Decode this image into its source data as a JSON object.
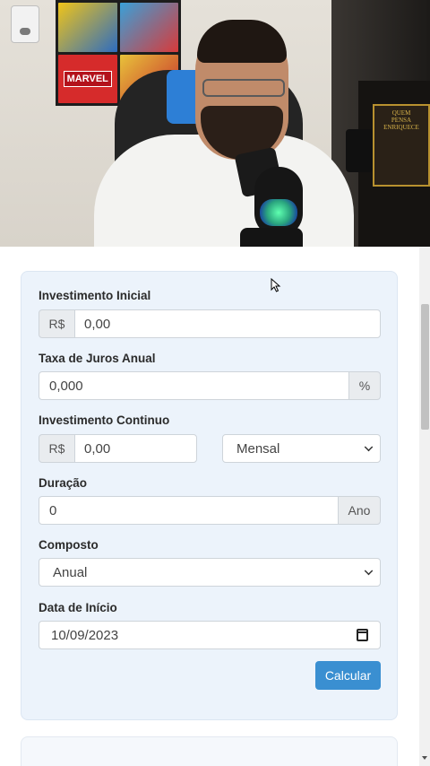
{
  "video": {
    "poster_text": "MARVEL COMICS",
    "book_text": "NAPOLEON HILL QUEM PENSA ENRIQUECE"
  },
  "form": {
    "initial_label": "Investimento Inicial",
    "initial_prefix": "R$",
    "initial_value": "0,00",
    "rate_label": "Taxa de Juros Anual",
    "rate_value": "0,000",
    "rate_suffix": "%",
    "contrib_label": "Investimento Continuo",
    "contrib_prefix": "R$",
    "contrib_value": "0,00",
    "contrib_frequency": "Mensal",
    "duration_label": "Duração",
    "duration_value": "0",
    "duration_suffix": "Ano",
    "compound_label": "Composto",
    "compound_value": "Anual",
    "start_date_label": "Data de Início",
    "start_date_value": "10/09/2023",
    "calculate_button": "Calcular"
  },
  "colors": {
    "card_bg": "#ecf3fb",
    "button_bg": "#3a8fd1",
    "addon_bg": "#e9ecef"
  },
  "icons": [
    "chevron-down-icon",
    "calendar-icon",
    "mouse-pointer-icon"
  ]
}
